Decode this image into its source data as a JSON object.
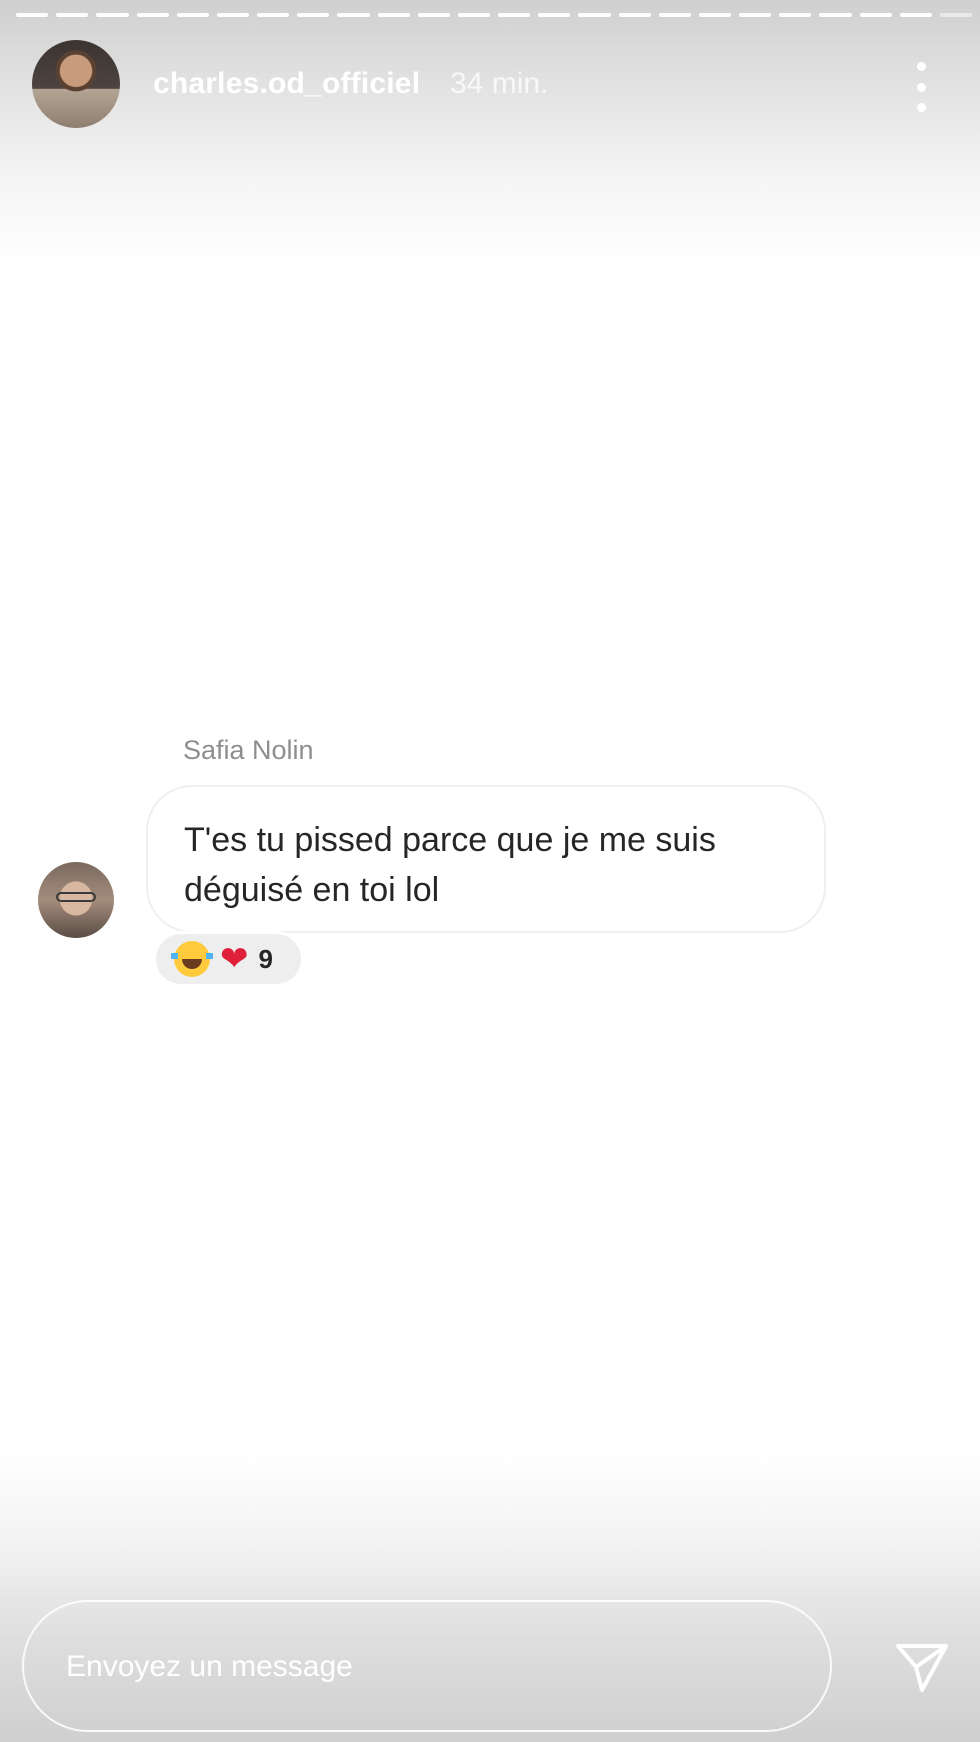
{
  "story": {
    "progress": {
      "segments_total": 24,
      "segments_viewed": 23
    },
    "header": {
      "username": "charles.od_officiel",
      "timestamp": "34 min.",
      "avatar_icon": "profile-photo",
      "more_icon": "more-vertical-icon"
    }
  },
  "message": {
    "sender_name": "Safia Nolin",
    "text": "T'es tu pissed parce que je me suis déguisé en toi lol",
    "avatar_icon": "profile-photo",
    "reactions": {
      "emojis": [
        "😂",
        "❤"
      ],
      "count": "9"
    }
  },
  "composer": {
    "placeholder": "Envoyez un message",
    "send_icon": "send-icon"
  },
  "colors": {
    "username": "#ffffff",
    "bubble_text": "#262626",
    "sender_name": "#8e8e8e",
    "heart": "#e0203a"
  }
}
